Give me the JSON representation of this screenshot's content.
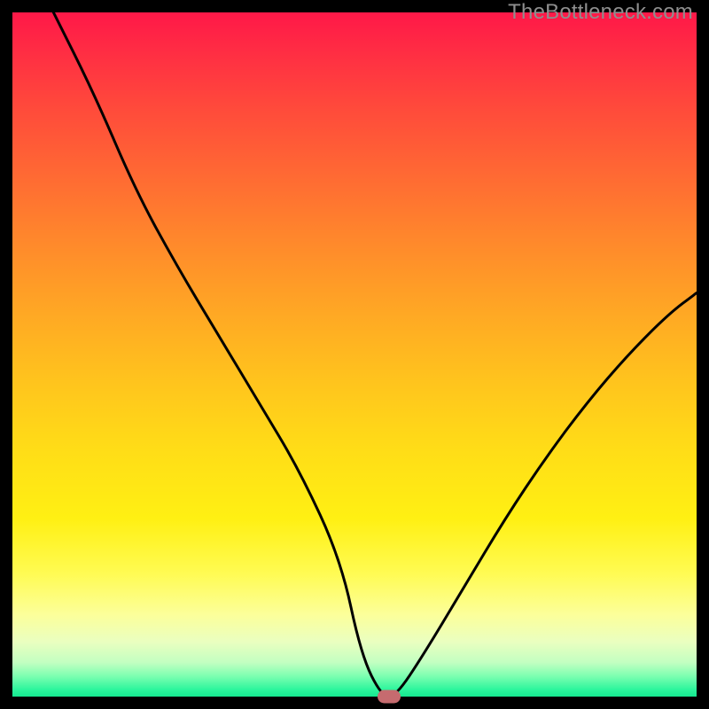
{
  "watermark": "TheBottleneck.com",
  "chart_data": {
    "type": "line",
    "title": "",
    "xlabel": "",
    "ylabel": "",
    "xlim": [
      0,
      100
    ],
    "ylim": [
      0,
      100
    ],
    "series": [
      {
        "name": "bottleneck-curve",
        "x": [
          0,
          6,
          12,
          18,
          24,
          30,
          36,
          42,
          48,
          51,
          54,
          56,
          60,
          66,
          72,
          78,
          84,
          90,
          96,
          100
        ],
        "values": [
          112,
          100,
          88,
          74,
          63,
          53,
          43,
          33,
          20,
          6,
          0,
          0,
          6,
          16,
          26,
          35,
          43,
          50,
          56,
          59
        ]
      }
    ],
    "marker": {
      "x": 55,
      "y": 0
    },
    "background_gradient_top": "#ff1848",
    "background_gradient_bottom": "#15e890",
    "curve_color": "#000000",
    "marker_color": "#c66b6f"
  }
}
